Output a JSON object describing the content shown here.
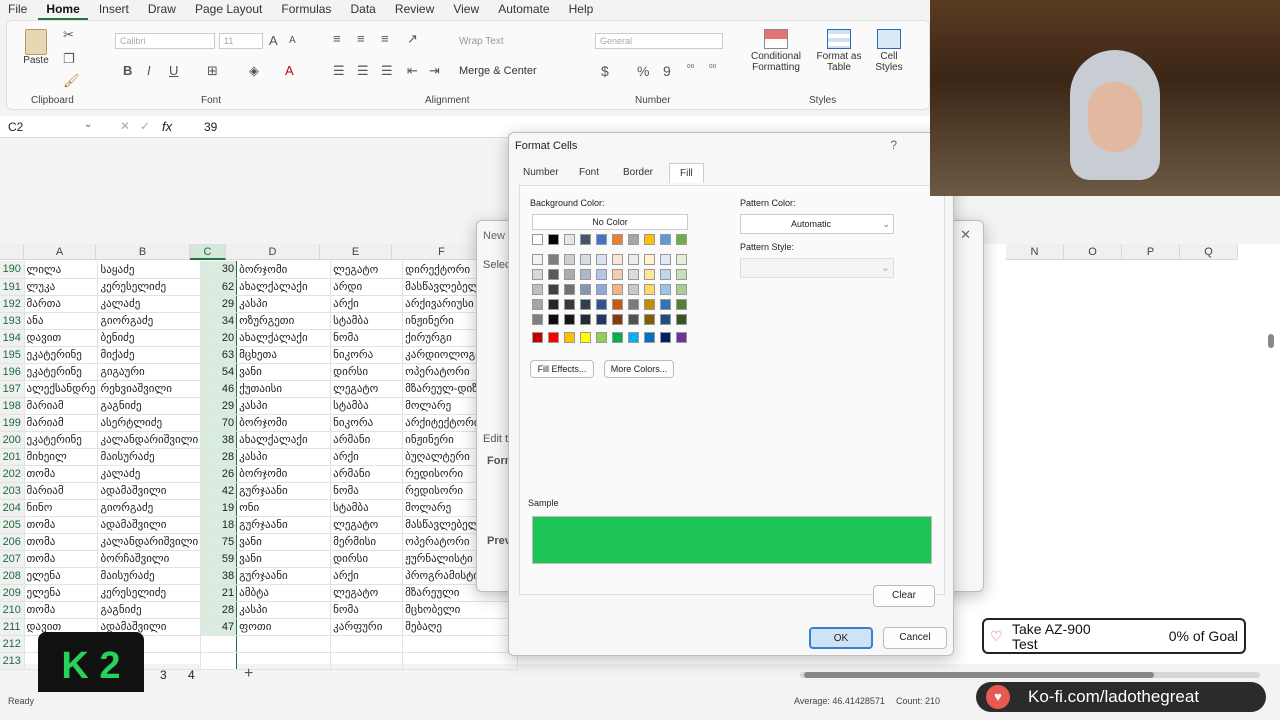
{
  "menu": [
    "File",
    "Home",
    "Insert",
    "Draw",
    "Page Layout",
    "Formulas",
    "Data",
    "Review",
    "View",
    "Automate",
    "Help"
  ],
  "ribbon": {
    "clipboard": {
      "paste": "Paste",
      "label": "Clipboard"
    },
    "font": {
      "name": "Calibri",
      "size": "11",
      "bold": "B",
      "italic": "I",
      "underline": "U",
      "label": "Font"
    },
    "alignment": {
      "wrap": "Wrap Text",
      "merge": "Merge & Center",
      "label": "Alignment"
    },
    "number": {
      "format": "General",
      "currency": "$",
      "percent": "%",
      "comma": "9",
      "label": "Number"
    },
    "styles": {
      "conditional": "Conditional Formatting",
      "table": "Format as Table",
      "cell": "Cell Styles",
      "label": "Styles"
    }
  },
  "formula_bar": {
    "name_box": "C2",
    "fx": "fx",
    "value": "39"
  },
  "columns": [
    "A",
    "B",
    "C",
    "D",
    "E",
    "F"
  ],
  "right_columns": [
    "N",
    "O",
    "P",
    "Q"
  ],
  "rows": [
    [
      "190",
      "ლილა",
      "საყაძე",
      "30",
      "ბორჯომი",
      "ლეგატო",
      "დირექტორი"
    ],
    [
      "191",
      "ლუკა",
      "კერესელიძე",
      "62",
      "ახალქალაქი",
      "არდი",
      "მასწავლებელი"
    ],
    [
      "192",
      "მართა",
      "კალაძე",
      "29",
      "კასპი",
      "არქი",
      "არქივარიუსი"
    ],
    [
      "193",
      "ანა",
      "გიორგაძე",
      "34",
      "ოზურგეთი",
      "სტამბა",
      "ინჟინერი"
    ],
    [
      "194",
      "დავით",
      "ბენიძე",
      "20",
      "ახალქალაქი",
      "ნომა",
      "ქირურგი"
    ],
    [
      "195",
      "ეკატერინე",
      "მიქაძე",
      "63",
      "მცხეთა",
      "ნიკორა",
      "კარდიოლოგი"
    ],
    [
      "196",
      "ეკატერინე",
      "გიგაური",
      "54",
      "ვანი",
      "დირსი",
      "ოპერატორი"
    ],
    [
      "197",
      "ალექსანდრე",
      "რეხვიაშვილი",
      "46",
      "ქუთაისი",
      "ლეგატო",
      "მზარეულ-დიზაინერი"
    ],
    [
      "198",
      "მარიამ",
      "გაგნიძე",
      "29",
      "კასპი",
      "სტამბა",
      "მოლარე"
    ],
    [
      "199",
      "მარიამ",
      "ასერტლიძე",
      "70",
      "ბორჯომი",
      "ნიკორა",
      "არქიტექტორი"
    ],
    [
      "200",
      "ეკატერინე",
      "კალანდარიშვილი",
      "38",
      "ახალქალაქი",
      "არმანი",
      "ინჟინერი"
    ],
    [
      "201",
      "მიხეილ",
      "მაისურაძე",
      "28",
      "კასპი",
      "არქი",
      "ბუღალტერი"
    ],
    [
      "202",
      "თომა",
      "კალაძე",
      "26",
      "ბორჯომი",
      "არმანი",
      "რედისორი"
    ],
    [
      "203",
      "მარიამ",
      "ადამაშვილი",
      "42",
      "გურჯაანი",
      "ნომა",
      "რედისორი"
    ],
    [
      "204",
      "ნინო",
      "გიორგაძე",
      "19",
      "ონი",
      "სტამბა",
      "მოლარე"
    ],
    [
      "205",
      "თომა",
      "ადამაშვილი",
      "18",
      "გურჯაანი",
      "ლეგატო",
      "მასწავლებელი"
    ],
    [
      "206",
      "თომა",
      "კალანდარიშვილი",
      "75",
      "ვანი",
      "მერმისი",
      "ოპერატორი"
    ],
    [
      "207",
      "თომა",
      "ბორჩაშვილი",
      "59",
      "ვანი",
      "დირსი",
      "ჟურნალისტი"
    ],
    [
      "208",
      "ელენა",
      "მაისურაძე",
      "38",
      "გურჯაანი",
      "არქი",
      "პროგრამისტი"
    ],
    [
      "209",
      "ელენა",
      "კერესელიძე",
      "21",
      "ამბტა",
      "ლეგატო",
      "მზარეული"
    ],
    [
      "210",
      "თომა",
      "გაგნიძე",
      "28",
      "კასპი",
      "ნომა",
      "მცხობელი"
    ],
    [
      "211",
      "დავით",
      "ადამაშვილი",
      "47",
      "ფოთი",
      "კარფური",
      "მებაღე"
    ],
    [
      "212",
      "",
      "",
      "",
      "",
      "",
      ""
    ],
    [
      "213",
      "",
      "",
      "",
      "",
      "",
      ""
    ]
  ],
  "back_dialog": {
    "title": "New",
    "select": "Select",
    "edit": "Edit th",
    "format": "Form",
    "preview": "Previ"
  },
  "format_cells": {
    "title": "Format Cells",
    "help": "?",
    "tabs": [
      "Number",
      "Font",
      "Border",
      "Fill"
    ],
    "bg_label": "Background Color:",
    "no_color": "No Color",
    "fill_effects": "Fill Effects...",
    "more_colors": "More Colors...",
    "pattern_color_label": "Pattern Color:",
    "pattern_color_value": "Automatic",
    "pattern_style_label": "Pattern Style:",
    "sample_label": "Sample",
    "sample_color": "#1fc457",
    "clear": "Clear",
    "ok": "OK",
    "cancel": "Cancel"
  },
  "sheet_tabs": [
    "3",
    "4"
  ],
  "status": {
    "ready": "Ready",
    "average": "Average: 46.41428571",
    "count": "Count: 210"
  },
  "overlays": {
    "goal_text": "Take AZ-900 Test",
    "goal_pct": "0% of Goal",
    "kofi": "Ko-fi.com/ladothegreat",
    "k2_logo": "K 2"
  }
}
